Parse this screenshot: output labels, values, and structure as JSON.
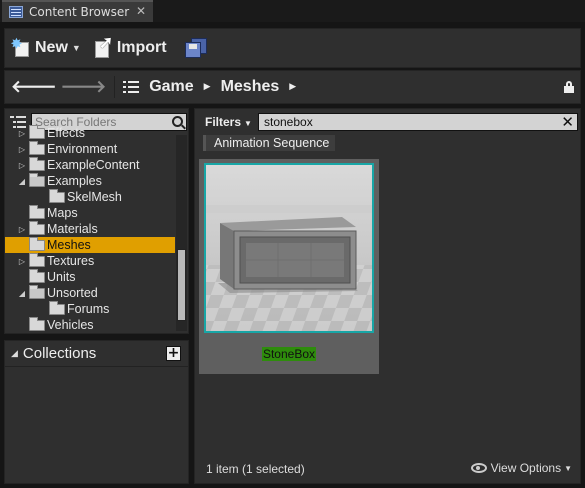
{
  "tab": {
    "title": "Content Browser",
    "close": "✕"
  },
  "toolbar": {
    "new_label": "New",
    "import_label": "Import"
  },
  "path": {
    "crumbs": [
      "Game",
      "Meshes"
    ]
  },
  "folders": {
    "search_placeholder": "Search Folders",
    "items": [
      {
        "label": "Effects",
        "expander": "▷",
        "depth": 0
      },
      {
        "label": "Environment",
        "expander": "▷",
        "depth": 0
      },
      {
        "label": "ExampleContent",
        "expander": "▷",
        "depth": 0
      },
      {
        "label": "Examples",
        "expander": "◢",
        "depth": 0,
        "open": true
      },
      {
        "label": "SkelMesh",
        "expander": "",
        "depth": 1
      },
      {
        "label": "Maps",
        "expander": "",
        "depth": 0
      },
      {
        "label": "Materials",
        "expander": "▷",
        "depth": 0
      },
      {
        "label": "Meshes",
        "expander": "",
        "depth": 0,
        "selected": true
      },
      {
        "label": "Textures",
        "expander": "▷",
        "depth": 0
      },
      {
        "label": "Units",
        "expander": "",
        "depth": 0
      },
      {
        "label": "Unsorted",
        "expander": "◢",
        "depth": 0,
        "open": true
      },
      {
        "label": "Forums",
        "expander": "",
        "depth": 1
      },
      {
        "label": "Vehicles",
        "expander": "",
        "depth": 0
      }
    ]
  },
  "collections": {
    "title": "Collections",
    "add": "+"
  },
  "assets": {
    "filters_label": "Filters",
    "filter_value": "stonebox",
    "clear": "✕",
    "chip": "Animation Sequence",
    "tile_label": "StoneBox",
    "status": "1 item (1 selected)",
    "view_options": "View Options"
  },
  "colors": {
    "selection": "#e09f00",
    "tile_border": "#18a6a6",
    "label_bg": "#2e8c0c"
  }
}
